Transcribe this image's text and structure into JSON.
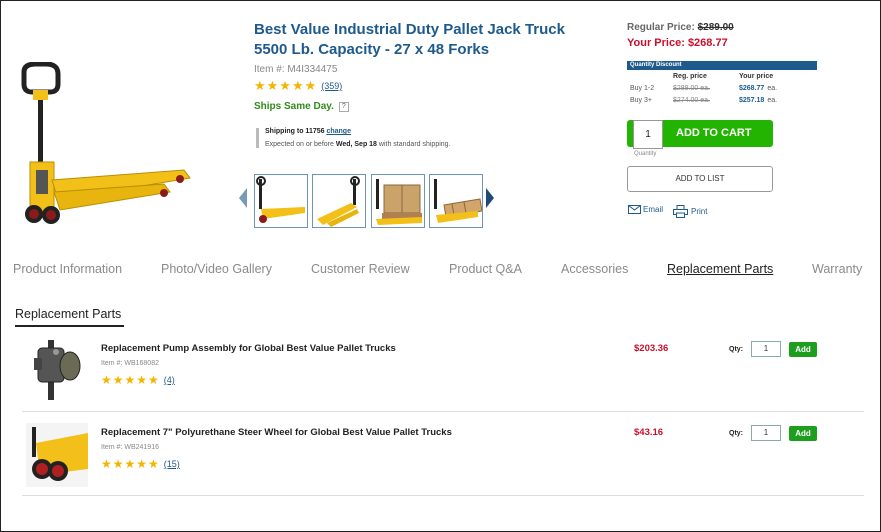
{
  "product": {
    "title": "Best Value Industrial Duty Pallet Jack Truck 5500 Lb. Capacity - 27 x 48 Forks",
    "item_number": "Item #: M4I334475",
    "rating_stars": "★★★★★",
    "review_count": "(359)",
    "ships_same_day": "Ships Same Day.",
    "help_icon": "?"
  },
  "shipping": {
    "shipping_to_label": "Shipping to 11756",
    "change_link": "change",
    "expected_prefix": "Expected on or before",
    "expected_date": "Wed, Sep 18",
    "expected_suffix": "with standard shipping."
  },
  "pricing": {
    "regular_label": "Regular Price:",
    "regular_value": "$289.00",
    "your_label": "Your Price:",
    "your_value": "$268.77",
    "quantity_discount": {
      "header": "Quantity Discount",
      "col_reg": "Reg. price",
      "col_your": "Your price",
      "rows": [
        {
          "qty": "Buy 1-2",
          "reg": "$289.00 ea.",
          "your": "$268.77",
          "unit": "ea."
        },
        {
          "qty": "Buy 3+",
          "reg": "$274.00 ea.",
          "your": "$257.18",
          "unit": "ea."
        }
      ]
    }
  },
  "purchase": {
    "quantity": "1",
    "quantity_caption": "Quantity",
    "add_to_cart": "ADD TO CART",
    "add_to_list": "ADD TO LIST",
    "email": "Email",
    "print": "Print"
  },
  "tabs": [
    {
      "label": "Product Information"
    },
    {
      "label": "Photo/Video Gallery"
    },
    {
      "label": "Customer Review"
    },
    {
      "label": "Product Q&A"
    },
    {
      "label": "Accessories"
    },
    {
      "label": "Replacement Parts",
      "active": true
    },
    {
      "label": "Warranty"
    }
  ],
  "replacement_parts": {
    "heading": "Replacement Parts",
    "qty_label": "Qty:",
    "add_label": "Add",
    "items": [
      {
        "title": "Replacement Pump Assembly for Global Best Value Pallet Trucks",
        "item": "Item #: WB168082",
        "stars": "★★★★★",
        "reviews": "(4)",
        "price": "$203.36",
        "qty": "1"
      },
      {
        "title": "Replacement 7\" Polyurethane Steer Wheel for Global Best Value Pallet Trucks",
        "item": "Item #: WB241916",
        "stars": "★★★★★",
        "reviews": "(15)",
        "price": "$43.16",
        "qty": "1"
      }
    ]
  },
  "colors": {
    "brand_blue": "#1e5a8c",
    "price_red": "#c8102e",
    "cart_green": "#22b400",
    "ships_green": "#2e8b1c",
    "star_gold": "#f5b400",
    "product_yellow": "#f2c018"
  },
  "icons": [
    "help-icon",
    "email-icon",
    "print-icon",
    "thumbnail-prev-arrow-icon",
    "thumbnail-next-arrow-icon",
    "star-icon"
  ]
}
